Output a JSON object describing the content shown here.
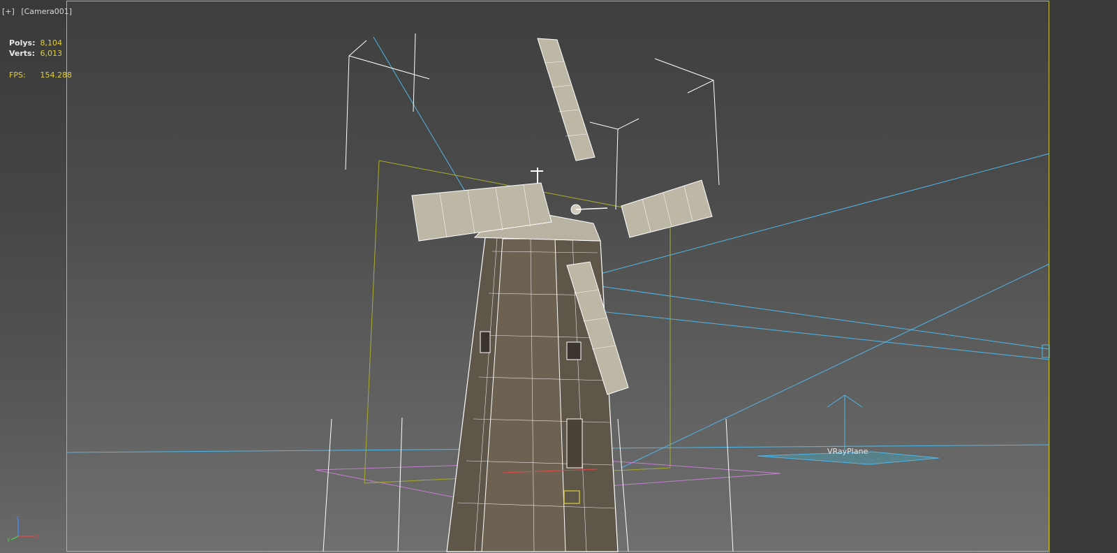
{
  "viewport": {
    "menu_label": "[+]",
    "camera_label": "[Camera001]"
  },
  "stats": {
    "polys_label": "Polys:",
    "polys_value": "8,104",
    "verts_label": "Verts:",
    "verts_value": "6,013",
    "fps_label": "FPS:",
    "fps_value": "154.288"
  },
  "scene": {
    "object_label": "VRayPlane"
  },
  "axis_gizmo": {
    "z": "z",
    "x": "x",
    "y": "y"
  },
  "colors": {
    "safe_frame": "#c9b92a",
    "stat_value": "#e0cf3c",
    "light_lines": "#4fb7e8",
    "wireframe": "#ffffff",
    "grid_plane": "#c47fd0",
    "bounding_box": "#a9ad2e"
  }
}
